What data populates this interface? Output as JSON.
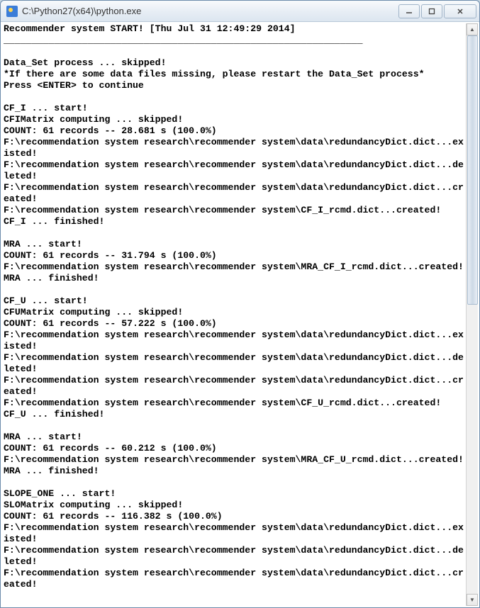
{
  "window": {
    "title": "C:\\Python27(x64)\\python.exe"
  },
  "console": {
    "lines": [
      "Recommender system START! [Thu Jul 31 12:49:29 2014]",
      "________________________________________________________________",
      "",
      "Data_Set process ... skipped!",
      "*If there are some data files missing, please restart the Data_Set process*",
      "Press <ENTER> to continue",
      "",
      "CF_I ... start!",
      "CFIMatrix computing ... skipped!",
      "COUNT: 61 records -- 28.681 s (100.0%)",
      "F:\\recommendation system research\\recommender system\\data\\redundancyDict.dict...existed!",
      "F:\\recommendation system research\\recommender system\\data\\redundancyDict.dict...deleted!",
      "F:\\recommendation system research\\recommender system\\data\\redundancyDict.dict...created!",
      "F:\\recommendation system research\\recommender system\\CF_I_rcmd.dict...created!",
      "CF_I ... finished!",
      "",
      "MRA ... start!",
      "COUNT: 61 records -- 31.794 s (100.0%)",
      "F:\\recommendation system research\\recommender system\\MRA_CF_I_rcmd.dict...created!",
      "MRA ... finished!",
      "",
      "CF_U ... start!",
      "CFUMatrix computing ... skipped!",
      "COUNT: 61 records -- 57.222 s (100.0%)",
      "F:\\recommendation system research\\recommender system\\data\\redundancyDict.dict...existed!",
      "F:\\recommendation system research\\recommender system\\data\\redundancyDict.dict...deleted!",
      "F:\\recommendation system research\\recommender system\\data\\redundancyDict.dict...created!",
      "F:\\recommendation system research\\recommender system\\CF_U_rcmd.dict...created!",
      "CF_U ... finished!",
      "",
      "MRA ... start!",
      "COUNT: 61 records -- 60.212 s (100.0%)",
      "F:\\recommendation system research\\recommender system\\MRA_CF_U_rcmd.dict...created!",
      "MRA ... finished!",
      "",
      "SLOPE_ONE ... start!",
      "SLOMatrix computing ... skipped!",
      "COUNT: 61 records -- 116.382 s (100.0%)",
      "F:\\recommendation system research\\recommender system\\data\\redundancyDict.dict...existed!",
      "F:\\recommendation system research\\recommender system\\data\\redundancyDict.dict...deleted!",
      "F:\\recommendation system research\\recommender system\\data\\redundancyDict.dict...created!"
    ]
  }
}
